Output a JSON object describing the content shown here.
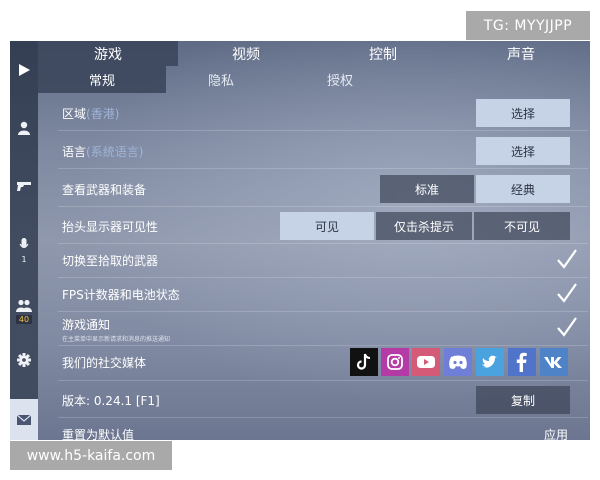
{
  "watermarks": {
    "top": "TG: MYYJJPP",
    "bottom": "www.h5-kaifa.com"
  },
  "sidebar": {
    "items": [
      {
        "icon": "play-icon"
      },
      {
        "icon": "person-icon"
      },
      {
        "icon": "gun-icon"
      },
      {
        "icon": "microphone-icon",
        "count": "1"
      },
      {
        "icon": "group-icon",
        "count": "40"
      },
      {
        "icon": "gear-icon"
      },
      {
        "icon": "mail-icon"
      }
    ]
  },
  "main_tabs": [
    "游戏",
    "视频",
    "控制",
    "声音"
  ],
  "sub_tabs": [
    "常规",
    "隐私",
    "授权"
  ],
  "rows": {
    "region": {
      "label": "区域",
      "hint": "(香港)",
      "button": "选择"
    },
    "language": {
      "label": "语言",
      "hint": "(系统语言)",
      "button": "选择"
    },
    "weapons": {
      "label": "查看武器和装备",
      "options": [
        "标准",
        "经典"
      ],
      "selected": "经典"
    },
    "hud": {
      "label": "抬头显示器可见性",
      "options": [
        "可见",
        "仅击杀提示",
        "不可见"
      ],
      "selected": "可见"
    },
    "switch_weapon": {
      "label": "切换至拾取的武器",
      "checked": true
    },
    "fps_battery": {
      "label": "FPS计数器和电池状态",
      "checked": true
    },
    "notifications": {
      "label": "游戏通知",
      "sublabel": "在主菜单中显示新请求和消息的推送通知",
      "checked": true
    },
    "social": {
      "label": "我们的社交媒体",
      "icons": [
        "tiktok-icon",
        "instagram-icon",
        "youtube-icon",
        "discord-icon",
        "twitter-icon",
        "facebook-icon",
        "vk-icon"
      ]
    },
    "version": {
      "label": "版本: 0.24.1 [F1]",
      "button": "复制"
    },
    "reset": {
      "label": "重置为默认值",
      "button": "应用"
    }
  },
  "colors": {
    "tiktok": "#111111",
    "instagram": "#b43aa6",
    "youtube": "#d45a78",
    "discord": "#6f7fd8",
    "twitter": "#4aa3df",
    "facebook": "#4f74c9",
    "vk": "#4f83c7",
    "selected_option": "#c6d2e6"
  }
}
